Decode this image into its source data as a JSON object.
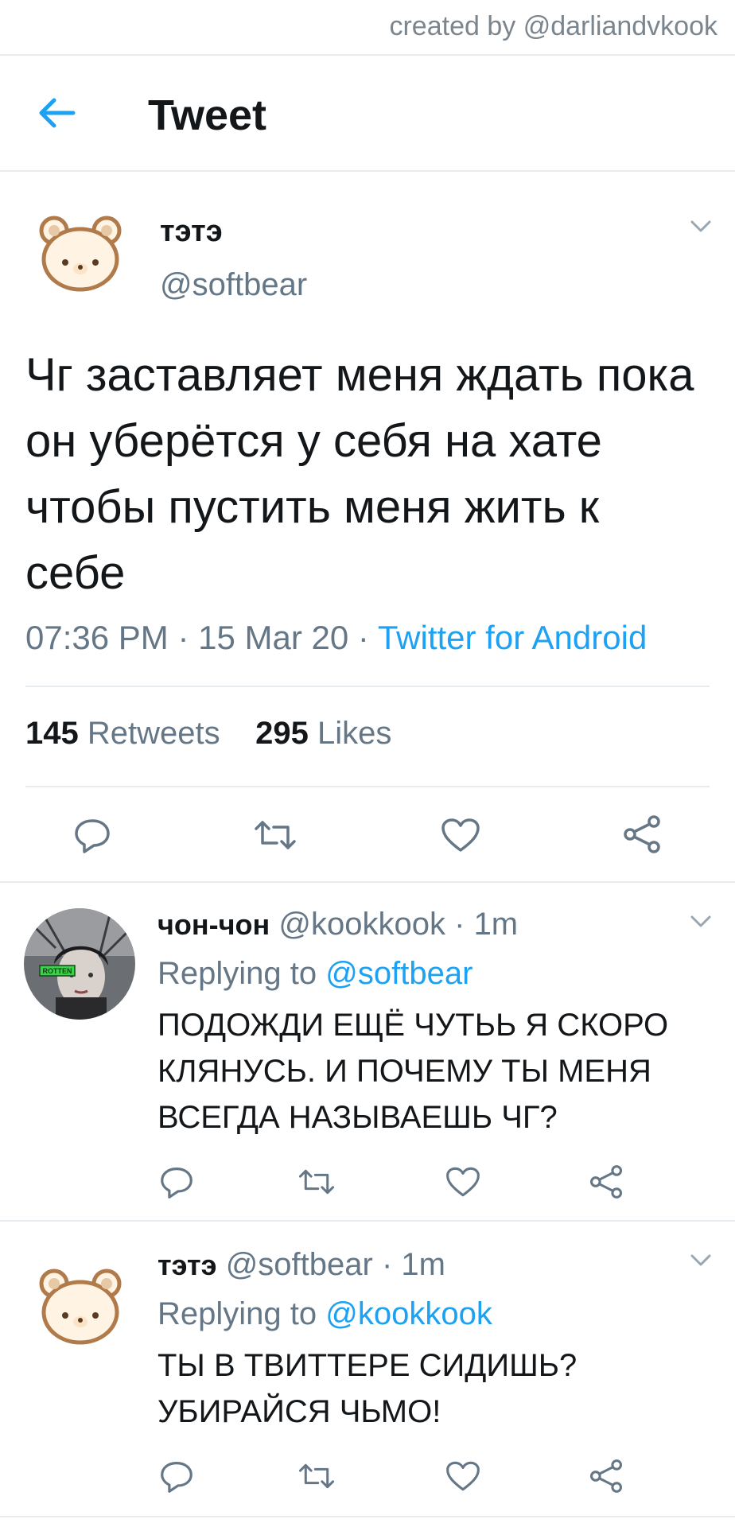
{
  "credit": "created by @darliandvkook",
  "header": {
    "title": "Tweet"
  },
  "main_tweet": {
    "name": "тэтэ",
    "handle": "@softbear",
    "text": "Чг заставляет меня ждать пока он уберётся у себя на хате чтобы пустить меня жить к себе",
    "time": "07:36 PM",
    "date": "15 Mar 20",
    "source": "Twitter for Android",
    "retweets": "145",
    "retweets_label": "Retweets",
    "likes": "295",
    "likes_label": "Likes"
  },
  "replies": [
    {
      "name": "чон-чон",
      "handle": "@kookkook",
      "time": "1m",
      "replying_prefix": "Replying to",
      "replying_to": "@softbear",
      "text": "ПОДОЖДИ ЕЩЁ ЧУТЬЬ Я СКОРО КЛЯНУСЬ. И ПОЧЕМУ ТЫ МЕНЯ ВСЕГДА НАЗЫВАЕШЬ ЧГ?",
      "avatar_badge": "ROTTEN"
    },
    {
      "name": "тэтэ",
      "handle": "@softbear",
      "time": "1m",
      "replying_prefix": "Replying to",
      "replying_to": "@kookkook",
      "text": "ТЫ В ТВИТТЕРЕ СИДИШЬ? УБИРАЙСЯ ЧЬМО!"
    }
  ],
  "separator": "·",
  "icons": [
    "back-arrow-icon",
    "chevron-down-icon",
    "reply-icon",
    "retweet-icon",
    "like-icon",
    "share-icon",
    "bear-avatar-icon"
  ],
  "colors": {
    "accent": "#1da1f2",
    "muted": "#657786",
    "divider": "#e6ecf0",
    "text": "#14171a"
  }
}
